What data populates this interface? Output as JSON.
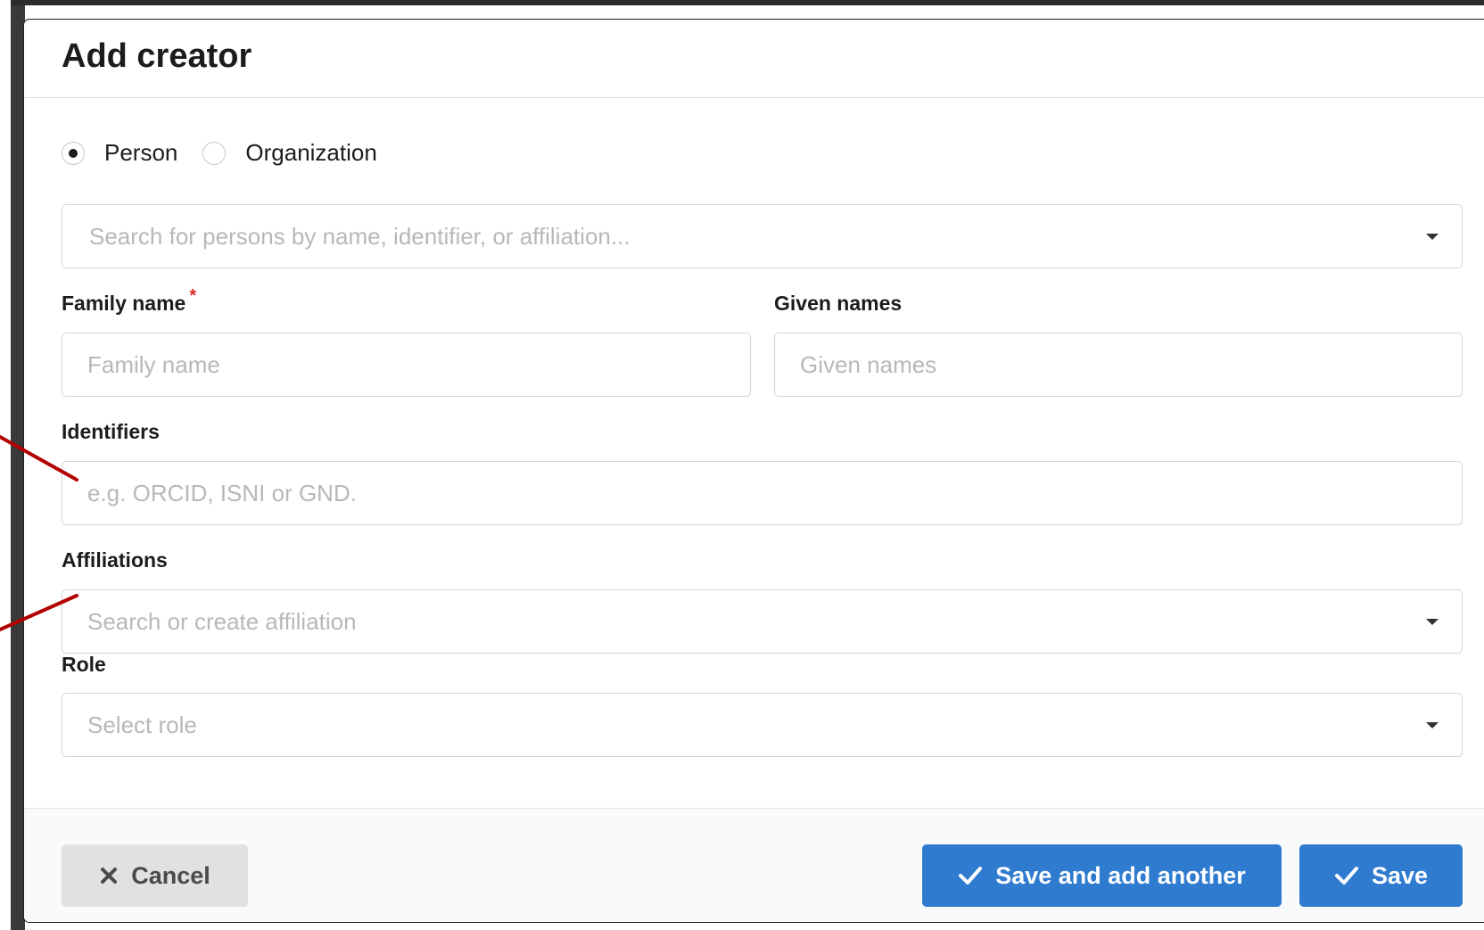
{
  "modal": {
    "title": "Add creator"
  },
  "creator_type": {
    "options": [
      {
        "label": "Person",
        "selected": true
      },
      {
        "label": "Organization",
        "selected": false
      }
    ]
  },
  "person_search": {
    "placeholder": "Search for persons by name, identifier, or affiliation..."
  },
  "family_name": {
    "label": "Family name",
    "required_mark": "*",
    "placeholder": "Family name",
    "value": ""
  },
  "given_names": {
    "label": "Given names",
    "placeholder": "Given names",
    "value": ""
  },
  "identifiers": {
    "label": "Identifiers",
    "placeholder": "e.g. ORCID, ISNI or GND."
  },
  "affiliations": {
    "label": "Affiliations",
    "placeholder": "Search or create affiliation"
  },
  "role": {
    "label": "Role",
    "placeholder": "Select role"
  },
  "footer": {
    "cancel_label": "Cancel",
    "save_another_label": "Save and add another",
    "save_label": "Save"
  },
  "colors": {
    "primary": "#2e7bcf",
    "cancel_bg": "#e0e1e2",
    "required": "#db2828",
    "annotation_arrow": "#b30000"
  },
  "icons": {
    "cancel": "close-icon",
    "save": "checkmark-icon",
    "dropdown": "caret-down-icon"
  }
}
